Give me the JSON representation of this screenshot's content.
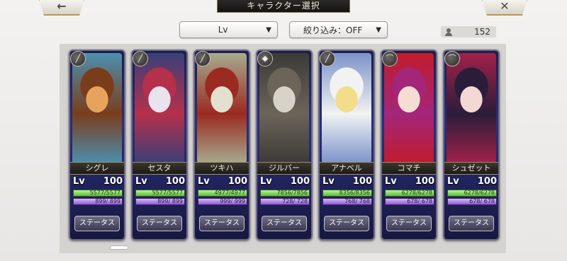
{
  "header": {
    "title": "キャラクター選択",
    "back_icon": "arrow-left-icon",
    "close_icon": "close-icon"
  },
  "controls": {
    "sort_label": "Lv",
    "filter_label": "絞り込み：OFF",
    "character_count": "152"
  },
  "characters": [
    {
      "name": "シグレ",
      "lv_label": "Lv",
      "lv": "100",
      "hp": "5577/5577",
      "mp": "899/ 899",
      "status_label": "ステータス",
      "weapon_icon": "spear-icon",
      "colors": [
        "#e7a35c",
        "#7a3d1c",
        "#4c8fb0"
      ]
    },
    {
      "name": "セスタ",
      "lv_label": "Lv",
      "lv": "100",
      "hp": "5577/5577",
      "mp": "899/ 899",
      "status_label": "ステータス",
      "weapon_icon": "spear-icon",
      "colors": [
        "#e9e3ee",
        "#b5304a",
        "#3b3f78"
      ]
    },
    {
      "name": "ツキハ",
      "lv_label": "Lv",
      "lv": "100",
      "hp": "4977/4977",
      "mp": "999/ 999",
      "status_label": "ステータス",
      "weapon_icon": "spear-icon",
      "colors": [
        "#e3e0cf",
        "#9b2a20",
        "#a6ab8f"
      ]
    },
    {
      "name": "ジルバー",
      "lv_label": "Lv",
      "lv": "100",
      "hp": "7856/7856",
      "mp": "728/ 728",
      "status_label": "ステータス",
      "weapon_icon": "gauntlet-icon",
      "colors": [
        "#d7d3c8",
        "#6b6559",
        "#3c3a37"
      ]
    },
    {
      "name": "アナベル",
      "lv_label": "Lv",
      "lv": "100",
      "hp": "8356/8356",
      "mp": "768/ 768",
      "status_label": "ステータス",
      "weapon_icon": "spear-icon",
      "colors": [
        "#f4dd8a",
        "#f2f2f2",
        "#7a93c9"
      ]
    },
    {
      "name": "コマチ",
      "lv_label": "Lv",
      "lv": "100",
      "hp": "6278/6278",
      "mp": "678/ 678",
      "status_label": "ステータス",
      "weapon_icon": "bow-icon",
      "colors": [
        "#f6ddd3",
        "#a3267a",
        "#c01c2c"
      ]
    },
    {
      "name": "シュゼット",
      "lv_label": "Lv",
      "lv": "100",
      "hp": "6278/6278",
      "mp": "678/ 678",
      "status_label": "ステータス",
      "weapon_icon": "bow-icon",
      "colors": [
        "#f3d8d6",
        "#2a1d3a",
        "#a2214a"
      ]
    }
  ]
}
